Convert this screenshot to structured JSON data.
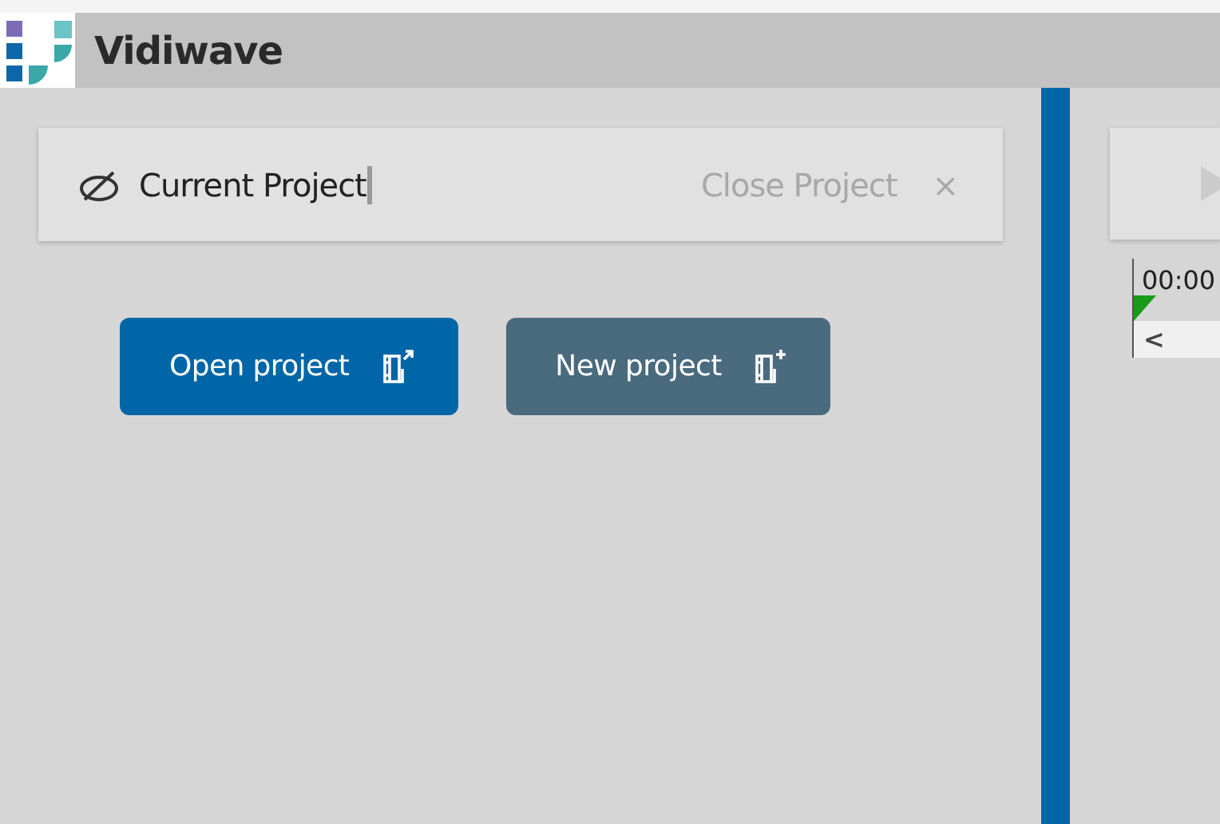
{
  "app": {
    "title": "Vidiwave"
  },
  "project_bar": {
    "label": "Current Project",
    "close": {
      "label": "Close Project",
      "icon": "×",
      "disabled": true
    }
  },
  "buttons": [
    {
      "label": "Open project",
      "kind": "open",
      "primary": true
    },
    {
      "label": "New project",
      "kind": "new",
      "primary": false
    }
  ],
  "timeline": {
    "time": "00:00",
    "scroll_left": "<"
  }
}
